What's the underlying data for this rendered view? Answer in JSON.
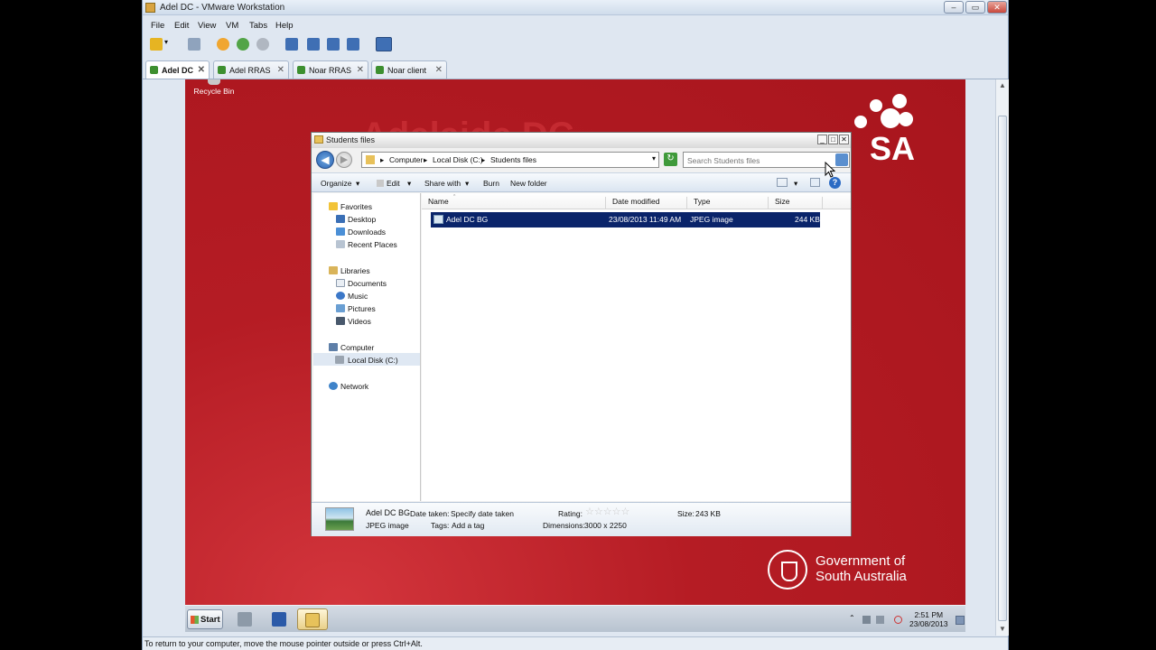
{
  "vmware": {
    "title": "Adel DC - VMware Workstation",
    "menu": [
      "File",
      "Edit",
      "View",
      "VM",
      "Tabs",
      "Help"
    ],
    "tabs": [
      {
        "label": "Adel DC",
        "active": true
      },
      {
        "label": "Adel RRAS",
        "active": false
      },
      {
        "label": "Noar RRAS",
        "active": false
      },
      {
        "label": "Noar client",
        "active": false
      }
    ],
    "status_text": "To return to your computer, move the mouse pointer outside or press Ctrl+Alt."
  },
  "desktop": {
    "recycle_bin_label": "Recycle Bin",
    "background_text": "Adelaide DC",
    "brand_text": "SA",
    "gov_line1": "Government of",
    "gov_line2": "South Australia"
  },
  "taskbar": {
    "start_label": "Start",
    "clock_time": "2:51 PM",
    "clock_date": "23/08/2013"
  },
  "explorer": {
    "title": "Students files",
    "breadcrumb": [
      "Computer",
      "Local Disk (C:)",
      "Students files"
    ],
    "search_placeholder": "Search Students files",
    "commands": [
      "Organize",
      "Edit",
      "Share with",
      "Burn",
      "New folder"
    ],
    "nav": {
      "favorites": "Favorites",
      "favorite_items": [
        "Desktop",
        "Downloads",
        "Recent Places"
      ],
      "libraries": "Libraries",
      "library_items": [
        "Documents",
        "Music",
        "Pictures",
        "Videos"
      ],
      "computer": "Computer",
      "computer_items": [
        "Local Disk (C:)"
      ],
      "network": "Network"
    },
    "columns": [
      "Name",
      "Date modified",
      "Type",
      "Size"
    ],
    "files": [
      {
        "name": "Adel DC BG",
        "date_modified": "23/08/2013 11:49 AM",
        "type": "JPEG image",
        "size": "244 KB"
      }
    ],
    "details": {
      "name": "Adel DC BG",
      "type": "JPEG image",
      "date_taken_label": "Date taken:",
      "date_taken_value": "Specify date taken",
      "tags_label": "Tags:",
      "tags_value": "Add a tag",
      "rating_label": "Rating:",
      "rating_value": 0,
      "dimensions_label": "Dimensions:",
      "dimensions_value": "3000 x 2250",
      "size_label": "Size:",
      "size_value": "243 KB"
    }
  },
  "colors": {
    "desktop_red": "#b51c24",
    "selection_blue": "#0a246a",
    "vmware_chrome": "#dfe7f1"
  }
}
